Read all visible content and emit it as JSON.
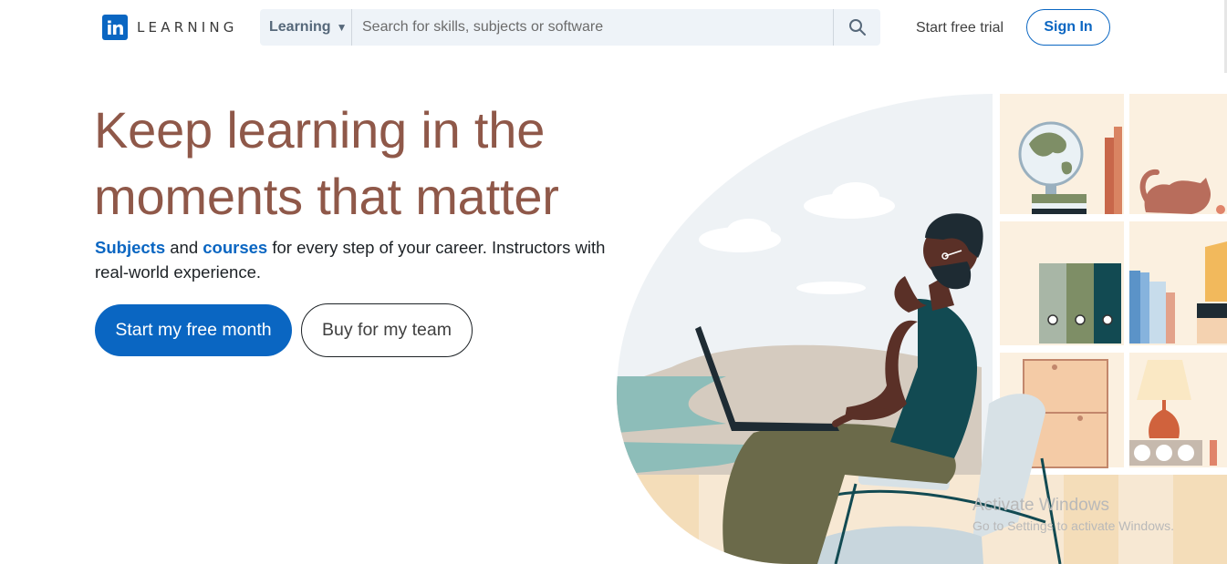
{
  "header": {
    "logo_mark": "in",
    "logo_word": "LEARNING",
    "search": {
      "category": "Learning",
      "placeholder": "Search for skills, subjects or software"
    },
    "start_trial": "Start free trial",
    "sign_in": "Sign In"
  },
  "hero": {
    "headline": "Keep learning in the moments that matter",
    "subjects_link": "Subjects",
    "and_text": " and ",
    "courses_link": "courses",
    "rest_text": " for every step of your career. Instructors with real-world experience.",
    "primary_cta": "Start my free month",
    "secondary_cta": "Buy for my team"
  },
  "watermark": {
    "title": "Activate Windows",
    "subtitle": "Go to Settings to activate Windows."
  },
  "colors": {
    "brand": "#0a66c2",
    "headline": "#8f5849"
  }
}
